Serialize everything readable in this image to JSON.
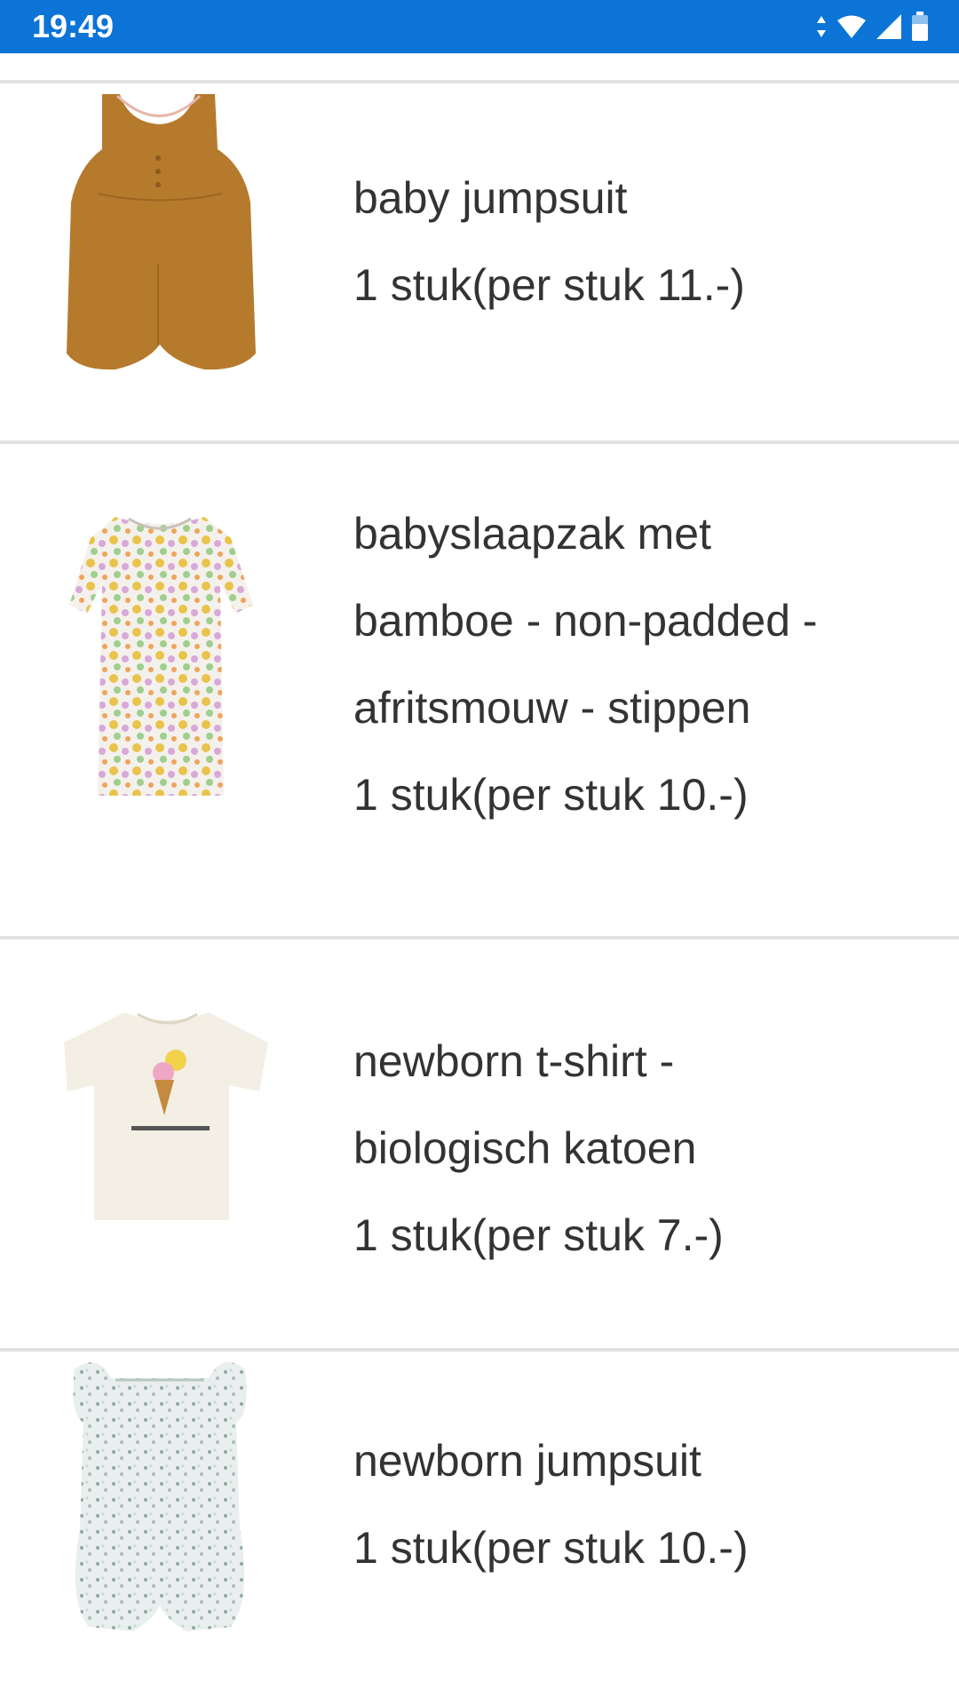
{
  "status_bar": {
    "time": "19:49",
    "icons": [
      "data-arrows-icon",
      "wifi-icon",
      "signal-icon",
      "battery-icon"
    ],
    "background_color": "#0b74d6"
  },
  "items": [
    {
      "name_lines": [
        "baby jumpsuit"
      ],
      "quantity": "1 stuk(per stuk 11.-)",
      "image": "brown-sleeveless-jumpsuit"
    },
    {
      "name_lines": [
        "babyslaapzak met",
        "bamboe - non-padded -",
        "afritsmouw - stippen"
      ],
      "quantity": "1 stuk(per stuk 10.-)",
      "image": "floral-sleeping-bag"
    },
    {
      "name_lines": [
        "newborn t-shirt -",
        "biologisch katoen"
      ],
      "quantity": "1 stuk(per stuk 7.-)",
      "image": "white-tshirt-ice-cream-print"
    },
    {
      "name_lines": [
        "newborn jumpsuit"
      ],
      "quantity": "1 stuk(per stuk 10.-)",
      "image": "floral-ruffle-romper"
    }
  ]
}
